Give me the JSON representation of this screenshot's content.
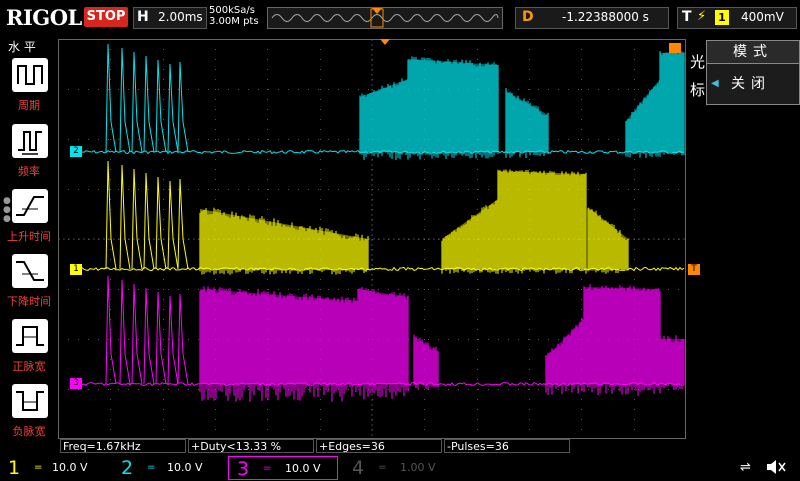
{
  "header": {
    "logo": "RIGOL",
    "run_state": "STOP",
    "timebase_label": "H",
    "timebase_value": "2.00ms",
    "sample_rate": "500kSa/s",
    "memory_depth": "3.00M pts",
    "delay_label": "D",
    "delay_value": "-1.22388000 s",
    "trigger_label": "T",
    "trigger_source": "1",
    "trigger_level": "400mV"
  },
  "left_menu": {
    "title": "水 平",
    "items": [
      {
        "label": "周期",
        "icon": "period-icon"
      },
      {
        "label": "频率",
        "icon": "frequency-icon"
      },
      {
        "label": "上升时间",
        "icon": "rise-time-icon"
      },
      {
        "label": "下降时间",
        "icon": "fall-time-icon"
      },
      {
        "label": "正脉宽",
        "icon": "positive-pulse-width-icon"
      },
      {
        "label": "负脉宽",
        "icon": "negative-pulse-width-icon"
      }
    ]
  },
  "right_panel": {
    "label_line1": "光",
    "label_line2": "标",
    "mode_label": "模式",
    "mode_value": "关闭"
  },
  "measurements": [
    {
      "text": "Freq=1.67kHz"
    },
    {
      "text": "+Duty<13.33 %"
    },
    {
      "text": "+Edges=36"
    },
    {
      "text": "-Pulses=36"
    }
  ],
  "channels": [
    {
      "num": "1",
      "coupling": "=",
      "scale": "10.0 V",
      "color": "#ffff00",
      "active": true
    },
    {
      "num": "2",
      "coupling": "=",
      "scale": "10.0 V",
      "color": "#00e5ee",
      "active": true
    },
    {
      "num": "3",
      "coupling": "=",
      "scale": "10.0 V",
      "color": "#ff00ff",
      "active": true
    },
    {
      "num": "4",
      "coupling": "=",
      "scale": "1.00 V",
      "color": "#555555",
      "active": false
    }
  ],
  "trace_markers": {
    "ch1": "1",
    "ch2": "2",
    "ch3": "3",
    "trigger": "T"
  },
  "status_icons": [
    "usb-icon",
    "speaker-mute-icon"
  ],
  "colors": {
    "ch1": "#ffff00",
    "ch2": "#00e5ee",
    "ch3": "#ff00ff",
    "trigger": "#ff8800",
    "grid": "#3a3a3a"
  }
}
